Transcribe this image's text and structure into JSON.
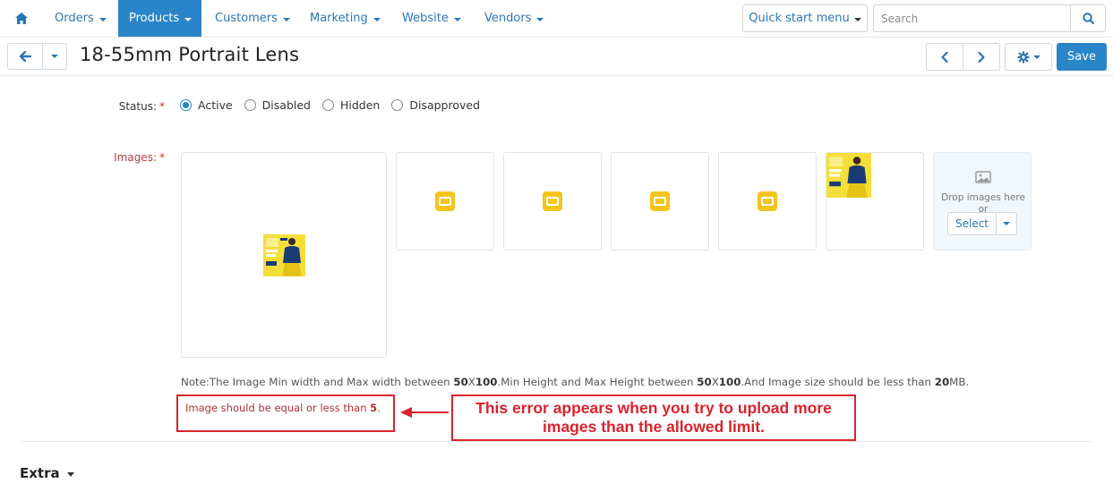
{
  "nav": {
    "items": [
      {
        "label": "Orders",
        "active": false
      },
      {
        "label": "Products",
        "active": true
      },
      {
        "label": "Customers",
        "active": false
      },
      {
        "label": "Marketing",
        "active": false
      },
      {
        "label": "Website",
        "active": false
      },
      {
        "label": "Vendors",
        "active": false
      }
    ],
    "quick_start": "Quick start menu",
    "search_placeholder": "Search"
  },
  "toolbar": {
    "title": "18-55mm Portrait Lens",
    "save_label": "Save"
  },
  "form": {
    "status_label": "Status:",
    "required_mark": "*",
    "status_options": [
      {
        "label": "Active",
        "checked": true
      },
      {
        "label": "Disabled",
        "checked": false
      },
      {
        "label": "Hidden",
        "checked": false
      },
      {
        "label": "Disapproved",
        "checked": false
      }
    ],
    "images_label": "Images:",
    "drop_text_1": "Drop images here",
    "drop_text_2": "or",
    "select_label": "Select",
    "note": {
      "p1": "Note:The Image Min width and Max width between ",
      "b1": "50",
      "p2": "X",
      "b2": "100",
      "p3": ".Min Height and Max Height between ",
      "b3": "50",
      "p4": "X",
      "b4": "100",
      "p5": ".And Image size should be less than ",
      "b5": "20",
      "p6": "MB."
    },
    "error_prefix": "Image should be equal or less than ",
    "error_value": "5",
    "error_suffix": "."
  },
  "annotation": {
    "line1": "This error appears when you try to upload more",
    "line2": "images than the allowed limit."
  },
  "section": {
    "extra": "Extra"
  },
  "colors": {
    "accent": "#2a85c8",
    "error_red": "#d9232d",
    "placeholder_yellow": "#f4c41c"
  }
}
